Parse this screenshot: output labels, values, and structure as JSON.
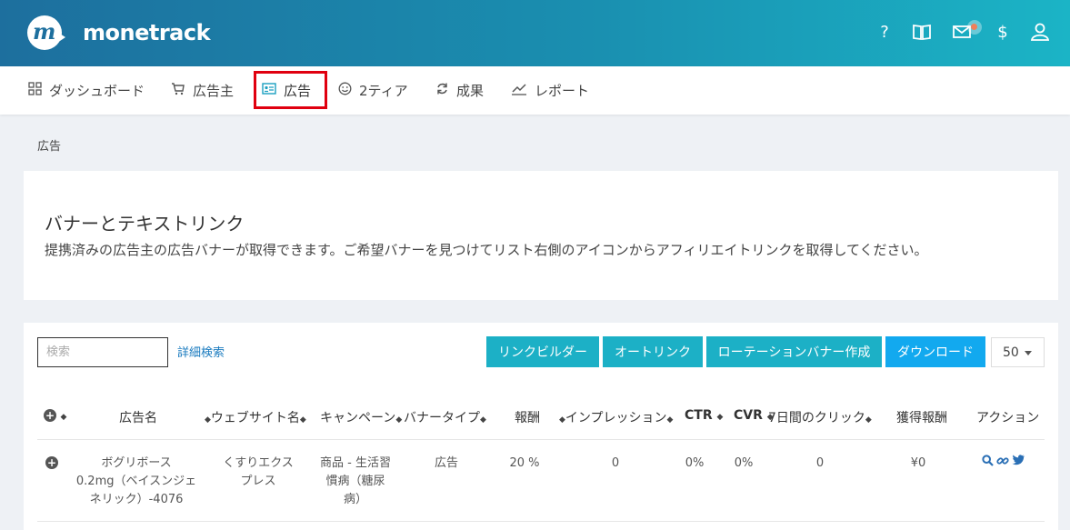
{
  "brand": {
    "name": "monetrack",
    "tm": "™",
    "mark": "m"
  },
  "topbar_icons": [
    {
      "name": "help-icon",
      "glyph": "?"
    },
    {
      "name": "book-icon",
      "glyph": "📖"
    },
    {
      "name": "mail-icon",
      "glyph": "✉"
    },
    {
      "name": "dollar-icon",
      "glyph": "$"
    },
    {
      "name": "user-icon",
      "glyph": "👤"
    }
  ],
  "nav": {
    "dashboard": "ダッシュボード",
    "advertisers": "広告主",
    "ads": "広告",
    "tier2": "2ティア",
    "results": "成果",
    "report": "レポート"
  },
  "breadcrumb": "広告",
  "intro": {
    "title": "バナーとテキストリンク",
    "description": "提携済みの広告主の広告バナーが取得できます。ご希望バナーを見つけてリスト右側のアイコンからアフィリエイトリンクを取得してください。"
  },
  "toolbar": {
    "search_placeholder": "検索",
    "advanced_search": "詳細検索",
    "link_builder": "リンクビルダー",
    "auto_link": "オートリンク",
    "rotation_banner": "ローテーションバナー作成",
    "download": "ダウンロード",
    "per_page": "50"
  },
  "table": {
    "headers": {
      "ad_name": "広告名",
      "website": "ウェブサイト名",
      "campaign": "キャンペーン",
      "banner_type": "バナータイプ",
      "reward": "報酬",
      "impressions": "インプレッション",
      "ctr": "CTR",
      "cvr": "CVR",
      "clicks7": "7日間のクリック",
      "earned": "獲得報酬",
      "action": "アクション"
    },
    "rows": [
      {
        "ad_name": [
          "ボグリボース",
          "0.2mg（ベイスンジェ",
          "ネリック）-4076"
        ],
        "website": [
          "くすりエクス",
          "プレス"
        ],
        "campaign": [
          "商品 - 生活習",
          "慣病（糖尿",
          "病）"
        ],
        "banner_type": "広告",
        "reward": "20 %",
        "impressions": "0",
        "ctr": "0%",
        "cvr": "0%",
        "clicks7": "0",
        "earned": "¥0"
      }
    ]
  },
  "colors": {
    "accent": "#1cb0c6",
    "primary": "#12a9ef",
    "link": "#1a7bbf",
    "highlight": "#e0000f"
  }
}
